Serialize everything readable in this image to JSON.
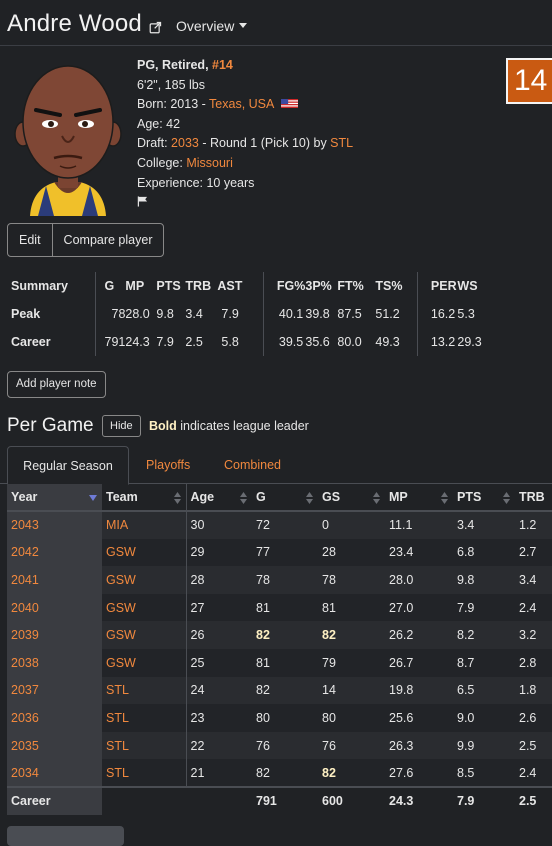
{
  "header": {
    "name": "Andre Wood",
    "overview_label": "Overview"
  },
  "jersey_number_box": "14",
  "bio": {
    "position_status": "PG, Retired, ",
    "number": "#14",
    "height_weight": "6'2\", 185 lbs",
    "born_label": "Born: 2013 - ",
    "born_place": "Texas, USA",
    "age": "Age: 42",
    "draft_label": "Draft: ",
    "draft_year": "2033",
    "draft_detail": " - Round 1 (Pick 10) by ",
    "draft_team": "STL",
    "college_label": "College: ",
    "college": "Missouri",
    "experience": "Experience: 10 years"
  },
  "buttons": {
    "edit": "Edit",
    "compare": "Compare player",
    "add_note": "Add player note",
    "hide": "Hide"
  },
  "summary": {
    "headers": [
      "Summary",
      "G",
      "MP",
      "PTS",
      "TRB",
      "AST",
      "FG%",
      "3P%",
      "FT%",
      "TS%",
      "PER",
      "WS"
    ],
    "rows": [
      {
        "label": "Peak",
        "values": [
          "78",
          "28.0",
          "9.8",
          "3.4",
          "7.9",
          "40.1",
          "39.8",
          "87.5",
          "51.2",
          "16.2",
          "5.3"
        ]
      },
      {
        "label": "Career",
        "values": [
          "791",
          "24.3",
          "7.9",
          "2.5",
          "5.8",
          "39.5",
          "35.6",
          "80.0",
          "49.3",
          "13.2",
          "29.3"
        ]
      }
    ]
  },
  "per_game": {
    "title": "Per Game",
    "legend_bold": "Bold",
    "legend_rest": " indicates league leader",
    "tabs": [
      "Regular Season",
      "Playoffs",
      "Combined"
    ],
    "columns": [
      "Year",
      "Team",
      "Age",
      "G",
      "GS",
      "MP",
      "PTS",
      "TRB"
    ],
    "rows": [
      [
        "2043",
        "MIA",
        "30",
        "72",
        "0",
        "11.1",
        "3.4",
        "1.2"
      ],
      [
        "2042",
        "GSW",
        "29",
        "77",
        "28",
        "23.4",
        "6.8",
        "2.7"
      ],
      [
        "2041",
        "GSW",
        "28",
        "78",
        "78",
        "28.0",
        "9.8",
        "3.4"
      ],
      [
        "2040",
        "GSW",
        "27",
        "81",
        "81",
        "27.0",
        "7.9",
        "2.4"
      ],
      [
        "2039",
        "GSW",
        "26",
        "82",
        "82",
        "26.2",
        "8.2",
        "3.2"
      ],
      [
        "2038",
        "GSW",
        "25",
        "81",
        "79",
        "26.7",
        "8.7",
        "2.8"
      ],
      [
        "2037",
        "STL",
        "24",
        "82",
        "14",
        "19.8",
        "6.5",
        "1.8"
      ],
      [
        "2036",
        "STL",
        "23",
        "80",
        "80",
        "25.6",
        "9.0",
        "2.6"
      ],
      [
        "2035",
        "STL",
        "22",
        "76",
        "76",
        "26.3",
        "9.9",
        "2.5"
      ],
      [
        "2034",
        "STL",
        "21",
        "82",
        "82",
        "27.6",
        "8.5",
        "2.4"
      ]
    ],
    "leaders": [
      [
        4,
        3
      ],
      [
        4,
        4
      ],
      [
        9,
        4
      ]
    ],
    "career": [
      "Career",
      "",
      "",
      "791",
      "600",
      "24.3",
      "7.9",
      "2.5"
    ]
  },
  "icons": {
    "external": "external-link-icon",
    "flag_us": "us-flag-icon",
    "flag": "flag-icon",
    "sort": "sort-icon"
  }
}
